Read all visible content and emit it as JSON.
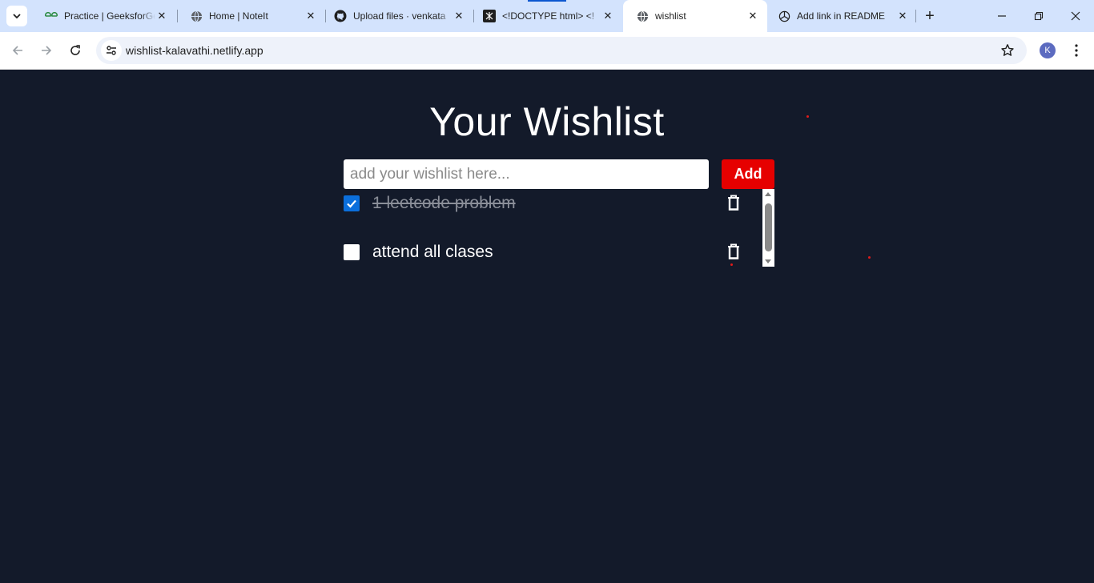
{
  "browser": {
    "tabs": [
      {
        "title": "Practice | GeeksforGeeks",
        "icon": "gfg-icon",
        "active": false
      },
      {
        "title": "Home | NoteIt",
        "icon": "globe-icon",
        "active": false
      },
      {
        "title": "Upload files · venkata",
        "icon": "github-icon",
        "active": false
      },
      {
        "title": "<!DOCTYPE html> <!",
        "icon": "doctype-icon",
        "active": false
      },
      {
        "title": "wishlist",
        "icon": "globe-icon",
        "active": true
      },
      {
        "title": "Add link in README",
        "icon": "openai-icon",
        "active": false
      }
    ],
    "close_glyph": "✕",
    "new_tab_glyph": "+",
    "url": "wishlist-kalavathi.netlify.app",
    "profile_initial": "K"
  },
  "app": {
    "heading": "Your Wishlist",
    "input_placeholder": "add your wishlist here...",
    "add_label": "Add",
    "items": [
      {
        "text": "1 leetcode problem",
        "checked": true
      },
      {
        "text": "attend all clases",
        "checked": false
      }
    ]
  },
  "colors": {
    "page_bg": "#131a2a",
    "accent_red": "#e60000",
    "checkbox_blue": "#0b6fdc"
  }
}
